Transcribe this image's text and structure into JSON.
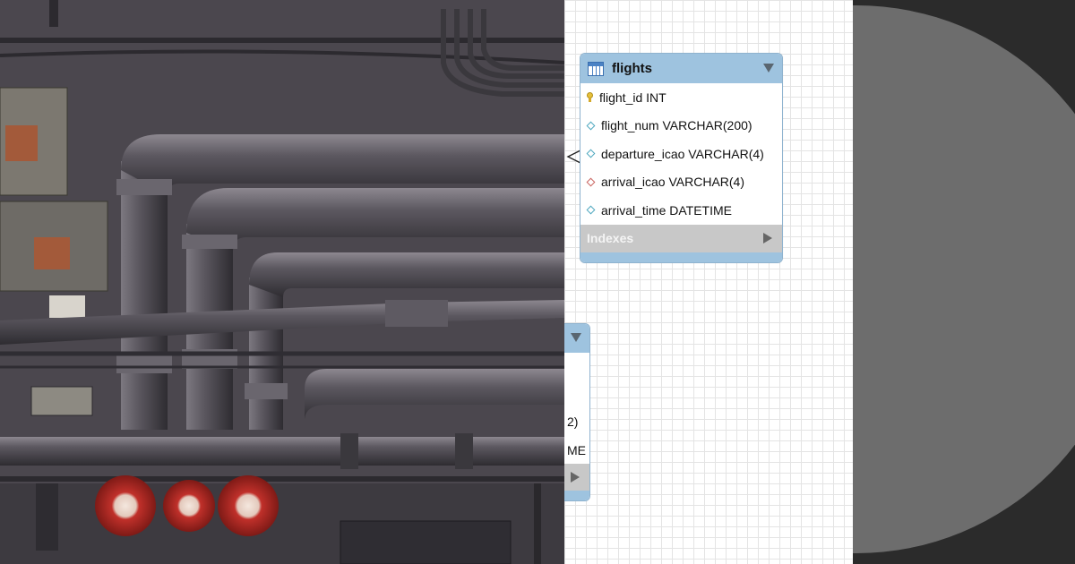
{
  "photo": {
    "icon": "pipes-photo"
  },
  "erd": {
    "table": {
      "name": "flights",
      "columns": [
        {
          "label": "flight_id INT",
          "icon": "primary-key-icon"
        },
        {
          "label": "flight_num VARCHAR(200)",
          "icon": "column-diamond-icon"
        },
        {
          "label": "departure_icao VARCHAR(4)",
          "icon": "column-diamond-icon"
        },
        {
          "label": "arrival_icao VARCHAR(4)",
          "icon": "foreign-key-diamond-icon"
        },
        {
          "label": "arrival_time DATETIME",
          "icon": "column-diamond-icon"
        }
      ],
      "indexes_label": "Indexes"
    },
    "partial_table": {
      "fragment_1": "2)",
      "fragment_2": "ME"
    }
  },
  "colors": {
    "header_blue": "#9ec3df",
    "indexes_gray": "#c8c8c8",
    "circle_gray": "#6d6d6d",
    "background_dark": "#2b2b2b"
  }
}
